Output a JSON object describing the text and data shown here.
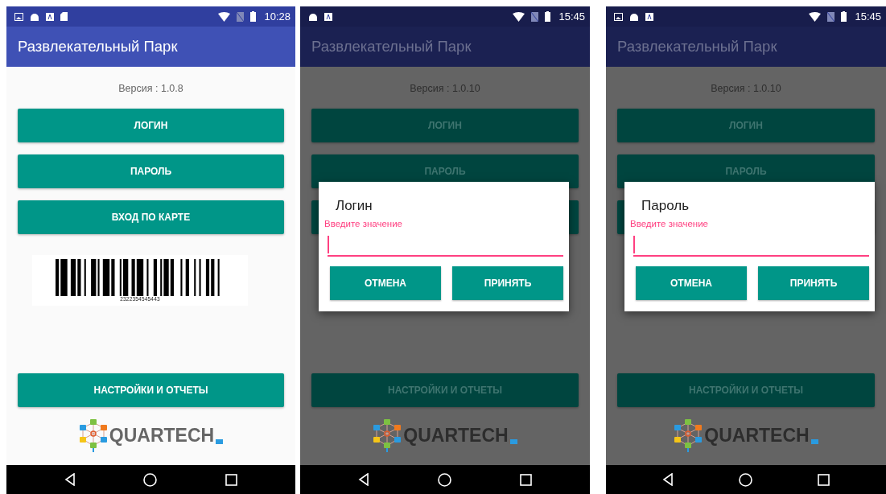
{
  "screens": [
    {
      "status_bar": {
        "notifications": [
          {
            "kind": "image"
          },
          {
            "kind": "android"
          },
          {
            "kind": "letter"
          },
          {
            "kind": "sdcard"
          }
        ],
        "time": "10:28"
      },
      "title": "Развлекательный Парк",
      "version": "Версия : 1.0.8",
      "buttons": [
        {
          "kind": "labeled",
          "label": "ЛОГИН"
        },
        {
          "kind": "labeled",
          "label": "ПАРОЛЬ"
        },
        {
          "kind": "labeled",
          "label": "ВХОД ПО КАРТЕ"
        }
      ],
      "barcode": {
        "number": "2322354545443"
      },
      "settings_button": "НАСТРОЙКИ И ОТЧЕТЫ",
      "logo": "QUARTECH"
    },
    {
      "status_bar": {
        "notifications": [
          {
            "kind": "android"
          },
          {
            "kind": "letter"
          }
        ],
        "time": "15:45"
      },
      "title": "Развлекательный Парк",
      "version": "Версия : 1.0.10",
      "buttons": [
        {
          "kind": "labeled",
          "label": "ЛОГИН"
        },
        {
          "kind": "labeled",
          "label": "ПАРОЛЬ"
        },
        {
          "kind": "covered"
        }
      ],
      "settings_button": "НАСТРОЙКИ И ОТЧЕТЫ",
      "logo": "QUARTECH",
      "dialog": {
        "title": "Логин",
        "hint": "Введите значение",
        "buttons": [
          "ОТМЕНА",
          "ПРИНЯТЬ"
        ]
      }
    },
    {
      "status_bar": {
        "notifications": [
          {
            "kind": "image"
          },
          {
            "kind": "android"
          },
          {
            "kind": "letter"
          }
        ],
        "time": "15:45"
      },
      "title": "Развлекательный Парк",
      "version": "Версия : 1.0.10",
      "buttons": [
        {
          "kind": "labeled",
          "label": "ЛОГИН"
        },
        {
          "kind": "labeled",
          "label": "ПАРОЛЬ"
        },
        {
          "kind": "covered"
        }
      ],
      "settings_button": "НАСТРОЙКИ И ОТЧЕТЫ",
      "logo": "QUARTECH",
      "dialog": {
        "title": "Пароль",
        "hint": "Введите значение",
        "buttons": [
          "ОТМЕНА",
          "ПРИНЯТЬ"
        ]
      }
    }
  ]
}
